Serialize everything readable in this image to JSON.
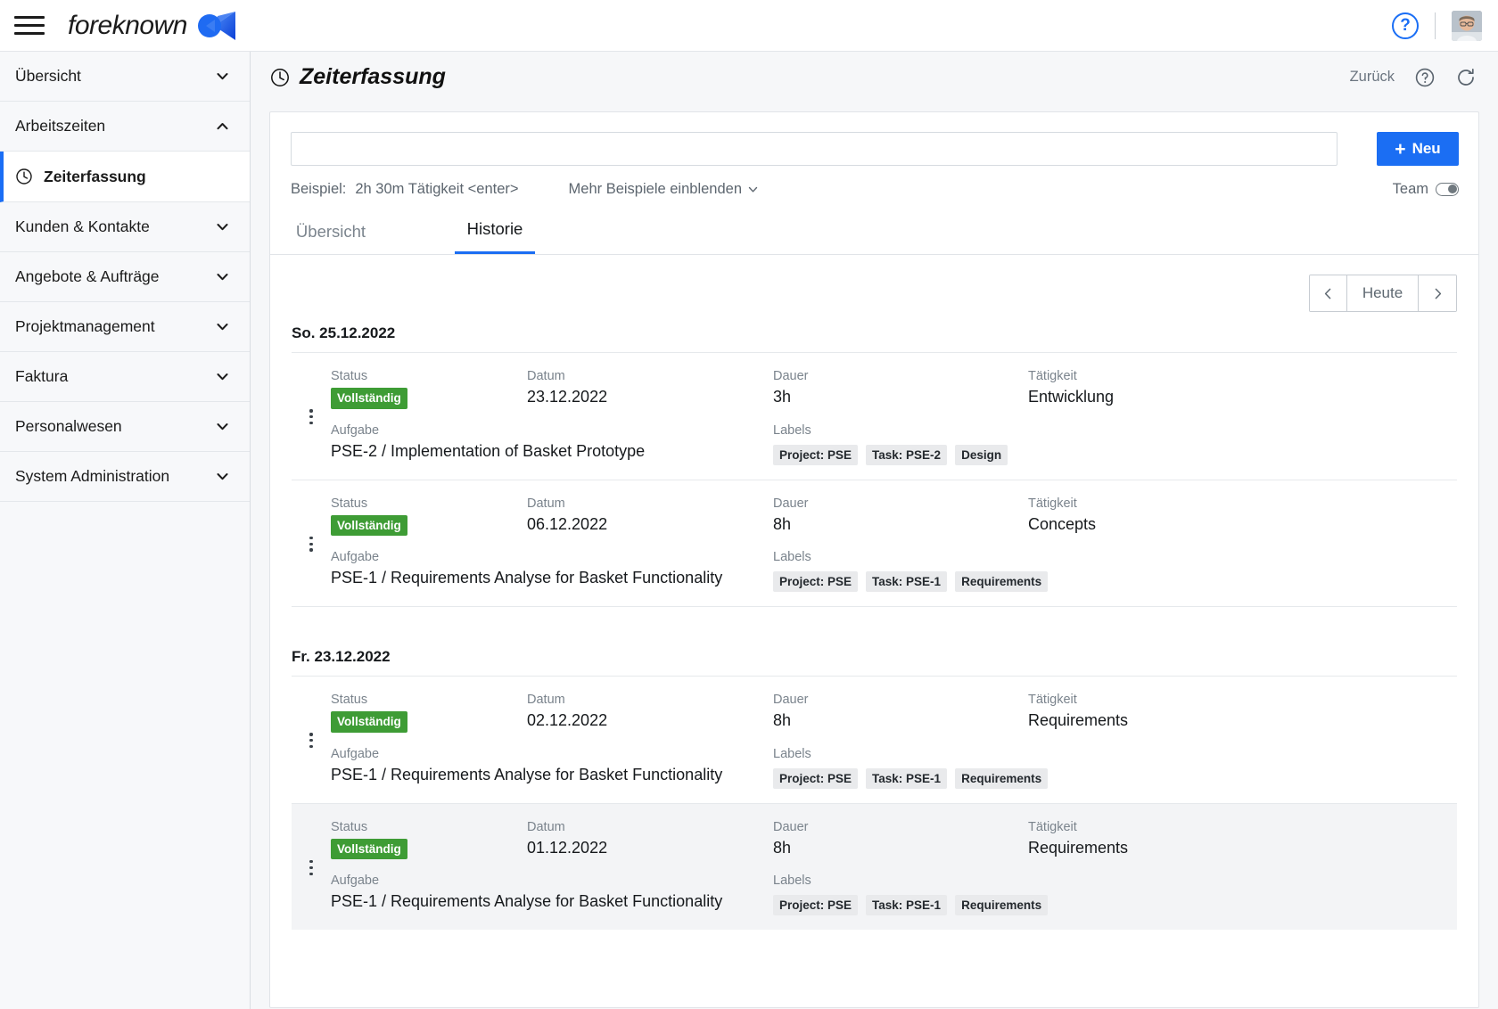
{
  "topbar": {
    "menu_icon": "hamburger-icon",
    "brand_name": "foreknown",
    "brand_mark_icon": "foreknown-logo-icon",
    "help_icon": "help-circle-icon",
    "help_label": "?",
    "avatar_icon": "user-avatar"
  },
  "sidebar": {
    "items": [
      {
        "label": "Übersicht",
        "state": "collapsed",
        "icon": "chevron-down-icon"
      },
      {
        "label": "Arbeitszeiten",
        "state": "expanded",
        "icon": "chevron-up-icon"
      },
      {
        "label": "Kunden & Kontakte",
        "state": "collapsed",
        "icon": "chevron-down-icon"
      },
      {
        "label": "Angebote & Aufträge",
        "state": "collapsed",
        "icon": "chevron-down-icon"
      },
      {
        "label": "Projektmanagement",
        "state": "collapsed",
        "icon": "chevron-down-icon"
      },
      {
        "label": "Faktura",
        "state": "collapsed",
        "icon": "chevron-down-icon"
      },
      {
        "label": "Personalwesen",
        "state": "collapsed",
        "icon": "chevron-down-icon"
      },
      {
        "label": "System Administration",
        "state": "collapsed",
        "icon": "chevron-down-icon"
      }
    ],
    "sub_item": {
      "label": "Zeiterfassung",
      "icon": "clock-icon",
      "active": true
    }
  },
  "page": {
    "title": "Zeiterfassung",
    "title_icon": "clock-icon",
    "back_label": "Zurück",
    "help_icon": "help-circle-icon",
    "refresh_icon": "refresh-icon"
  },
  "entry_bar": {
    "input_value": "",
    "input_placeholder": "",
    "new_button_label": "Neu",
    "new_button_icon": "plus-icon",
    "new_button_color": "#1b6ef3",
    "hint_prefix": "Beispiel:",
    "hint_example": "2h 30m Tätigkeit <enter>",
    "more_examples_label": "Mehr Beispiele einblenden",
    "more_examples_icon": "chevron-down-icon",
    "team_label": "Team",
    "team_toggle_state": "off"
  },
  "tabs": [
    {
      "label": "Übersicht",
      "active": false
    },
    {
      "label": "Historie",
      "active": true
    }
  ],
  "pager": {
    "prev_label": "‹",
    "prev_icon": "chevron-left-icon",
    "today_label": "Heute",
    "next_label": "›",
    "next_icon": "chevron-right-icon"
  },
  "column_labels": {
    "status": "Status",
    "datum": "Datum",
    "dauer": "Dauer",
    "taetigkeit": "Tätigkeit",
    "aufgabe": "Aufgabe",
    "labels": "Labels"
  },
  "status_badge_color": "#3e9c35",
  "days": [
    {
      "title": "So. 25.12.2022",
      "entries": [
        {
          "status": "Vollständig",
          "datum": "23.12.2022",
          "dauer": "3h",
          "taetigkeit": "Entwicklung",
          "aufgabe": "PSE-2 / Implementation of Basket Prototype",
          "labels": [
            "Project: PSE",
            "Task: PSE-2",
            "Design"
          ],
          "highlight": false
        },
        {
          "status": "Vollständig",
          "datum": "06.12.2022",
          "dauer": "8h",
          "taetigkeit": "Concepts",
          "aufgabe": "PSE-1 / Requirements Analyse for Basket Functionality",
          "labels": [
            "Project: PSE",
            "Task: PSE-1",
            "Requirements"
          ],
          "highlight": false
        }
      ]
    },
    {
      "title": "Fr. 23.12.2022",
      "entries": [
        {
          "status": "Vollständig",
          "datum": "02.12.2022",
          "dauer": "8h",
          "taetigkeit": "Requirements",
          "aufgabe": "PSE-1 / Requirements Analyse for Basket Functionality",
          "labels": [
            "Project: PSE",
            "Task: PSE-1",
            "Requirements"
          ],
          "highlight": false
        },
        {
          "status": "Vollständig",
          "datum": "01.12.2022",
          "dauer": "8h",
          "taetigkeit": "Requirements",
          "aufgabe": "PSE-1 / Requirements Analyse for Basket Functionality",
          "labels": [
            "Project: PSE",
            "Task: PSE-1",
            "Requirements"
          ],
          "highlight": true
        }
      ]
    }
  ]
}
